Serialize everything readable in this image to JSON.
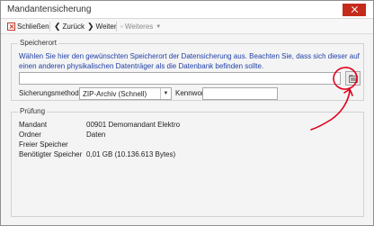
{
  "window": {
    "title": "Mandantensicherung"
  },
  "toolbar": {
    "close_label": "Schließen",
    "back_label": "Zurück",
    "next_label": "Weiter",
    "more_label": "Weiteres"
  },
  "location": {
    "group_title": "Speicherort",
    "info_text": "Wählen Sie hier den gewünschten Speicherort der Datensicherung aus. Beachten Sie, dass sich dieser auf einen anderen physikalischen Datenträger als die Datenbank befinden sollte.",
    "path_value": "",
    "method_label": "Sicherungsmethode",
    "method_value": "ZIP-Archiv (Schnell)",
    "password_label": "Kennwort",
    "password_value": ""
  },
  "check": {
    "group_title": "Prüfung",
    "rows": [
      {
        "label": "Mandant",
        "value": "00901  Demomandant Elektro"
      },
      {
        "label": "Ordner",
        "value": "Daten"
      },
      {
        "label": "Freier Speicher",
        "value": ""
      },
      {
        "label": "Benötigter Speicher",
        "value": "0,01 GB (10.136.613 Bytes)"
      }
    ]
  },
  "colors": {
    "info_text": "#1f3fa6",
    "close_button": "#c42b1c",
    "annotation": "#e0001b"
  },
  "icons": [
    "close-box-icon",
    "arrow-left-icon",
    "arrow-right-icon",
    "chevron-down-icon",
    "folder-browse-icon"
  ]
}
